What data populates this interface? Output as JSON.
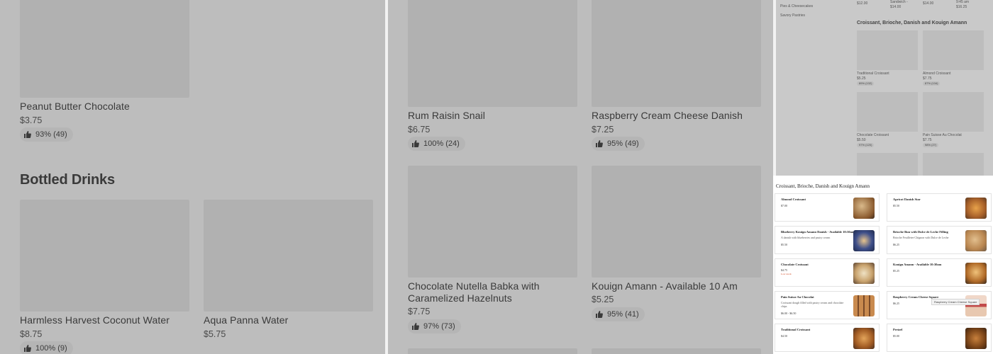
{
  "panel1": {
    "items": [
      {
        "name": "Peanut Butter Chocolate",
        "price": "$3.75",
        "rating": "93% (49)"
      },
      {
        "name": "Harmless Harvest Coconut Water",
        "price": "$8.75",
        "rating": "100% (9)"
      },
      {
        "name": "Aqua Panna Water",
        "price": "$5.75"
      }
    ],
    "section_title": "Bottled Drinks"
  },
  "panel2": {
    "items": [
      {
        "name": "Rum Raisin Snail",
        "price": "$6.75",
        "rating": "100% (24)"
      },
      {
        "name": "Raspberry Cream Cheese Danish",
        "price": "$7.25",
        "rating": "95% (49)"
      },
      {
        "name_line1": "Chocolate Nutella Babka with",
        "name_line2": "Caramelized Hazelnuts",
        "price": "$7.75",
        "rating": "97% (73)"
      },
      {
        "name": "Kouign Amann - Available 10 Am",
        "price": "$5.25",
        "rating": "95% (41)"
      }
    ]
  },
  "panel3_top": {
    "sidebar": [
      "Pies & Cheesecakes",
      "Savory Pastries"
    ],
    "top_prices": [
      "$12.00",
      "Sandwich -",
      "$14.00",
      "9:45 am"
    ],
    "top_prices_sub": [
      "$14.00",
      "$16.25"
    ],
    "section_title": "Croissant, Brioche, Danish and Kouign Amann",
    "items": [
      {
        "name": "Traditional Croissant",
        "price": "$5.25",
        "rating": "89% (132)"
      },
      {
        "name": "Almond Croissant",
        "price": "$7.75",
        "rating": "87% (134)"
      },
      {
        "name": "Chocolate Croissant",
        "price": "$5.50",
        "rating": "97% (120)"
      },
      {
        "name": "Pain Suisse Au Chocolat",
        "price": "$7.75",
        "rating": "98% (27)"
      }
    ]
  },
  "panel3_bottom": {
    "section_title": "Croissant, Brioche, Danish and Kouign Amann",
    "cards": [
      {
        "name": "Almond Croissant",
        "price": "$7.00",
        "desc": ""
      },
      {
        "name": "Apricot Danish Star",
        "price": "$5.50",
        "desc": ""
      },
      {
        "name": "Blueberry Kouign Amann Danish - Available 10:30am",
        "desc": "A danish with blueberries and pastry cream",
        "price": "$5.50"
      },
      {
        "name": "Brioche Bun with Dulce de Leche Filling",
        "desc": "Brioche Feuilletee Chignon with Dulce de Leche",
        "price": "$6.25"
      },
      {
        "name": "Chocolate Croissant",
        "price": "$4.75",
        "low": "Low stock"
      },
      {
        "name": "Kouign Amann - Available 10:30am",
        "price": "$5.25"
      },
      {
        "name": "Pain Suisse Au Chocolat",
        "desc": "Croissant dough filled with pastry cream and chocolate chips",
        "price": "$6.00 - $6.50"
      },
      {
        "name": "Raspberry Cream Cheese Square",
        "price": "$6.25",
        "tooltip": "Raspberry Cream Cheese Square"
      },
      {
        "name": "Traditional Croissant",
        "price": "$4.50"
      },
      {
        "name": "Pretzel",
        "price": "$5.00"
      }
    ]
  },
  "colors": {
    "overlay_gray": "#bdbdbd",
    "placeholder_gray": "#b1b1b1",
    "low_stock_red": "#d0421b"
  },
  "icons": {
    "rating": "thumbs-up-icon"
  }
}
